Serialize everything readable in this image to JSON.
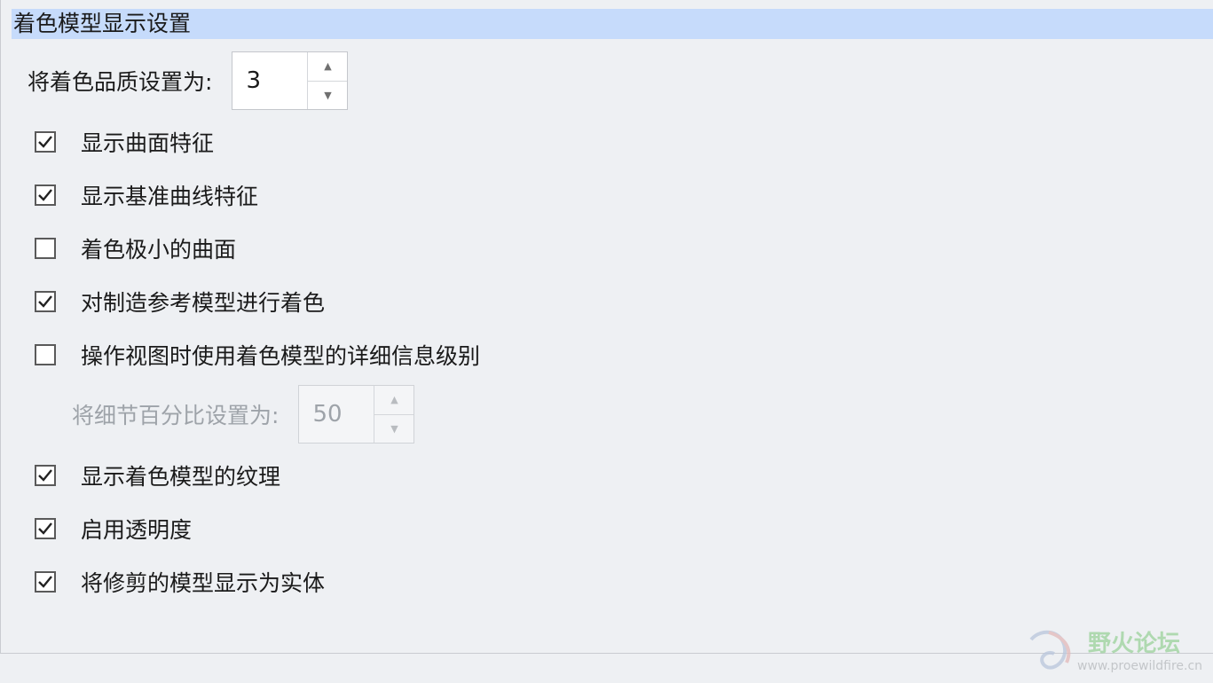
{
  "section": {
    "title": "着色模型显示设置"
  },
  "shading_quality": {
    "label": "将着色品质设置为:",
    "value": "3"
  },
  "options": [
    {
      "label": "显示曲面特征",
      "checked": true
    },
    {
      "label": "显示基准曲线特征",
      "checked": true
    },
    {
      "label": "着色极小的曲面",
      "checked": false
    },
    {
      "label": "对制造参考模型进行着色",
      "checked": true
    },
    {
      "label": "操作视图时使用着色模型的详细信息级别",
      "checked": false
    }
  ],
  "detail_percent": {
    "label": "将细节百分比设置为:",
    "value": "50",
    "enabled": false
  },
  "options2": [
    {
      "label": "显示着色模型的纹理",
      "checked": true
    },
    {
      "label": "启用透明度",
      "checked": true
    },
    {
      "label": "将修剪的模型显示为实体",
      "checked": true
    }
  ],
  "spinner_icons": {
    "up": "▲",
    "down": "▼"
  },
  "watermark": {
    "name": "野火论坛",
    "url": "www.proewildfire.cn"
  },
  "colors": {
    "header_bg": "#c6dbfb",
    "panel_bg": "#eef0f3",
    "disabled_text": "#9ea3a9"
  }
}
